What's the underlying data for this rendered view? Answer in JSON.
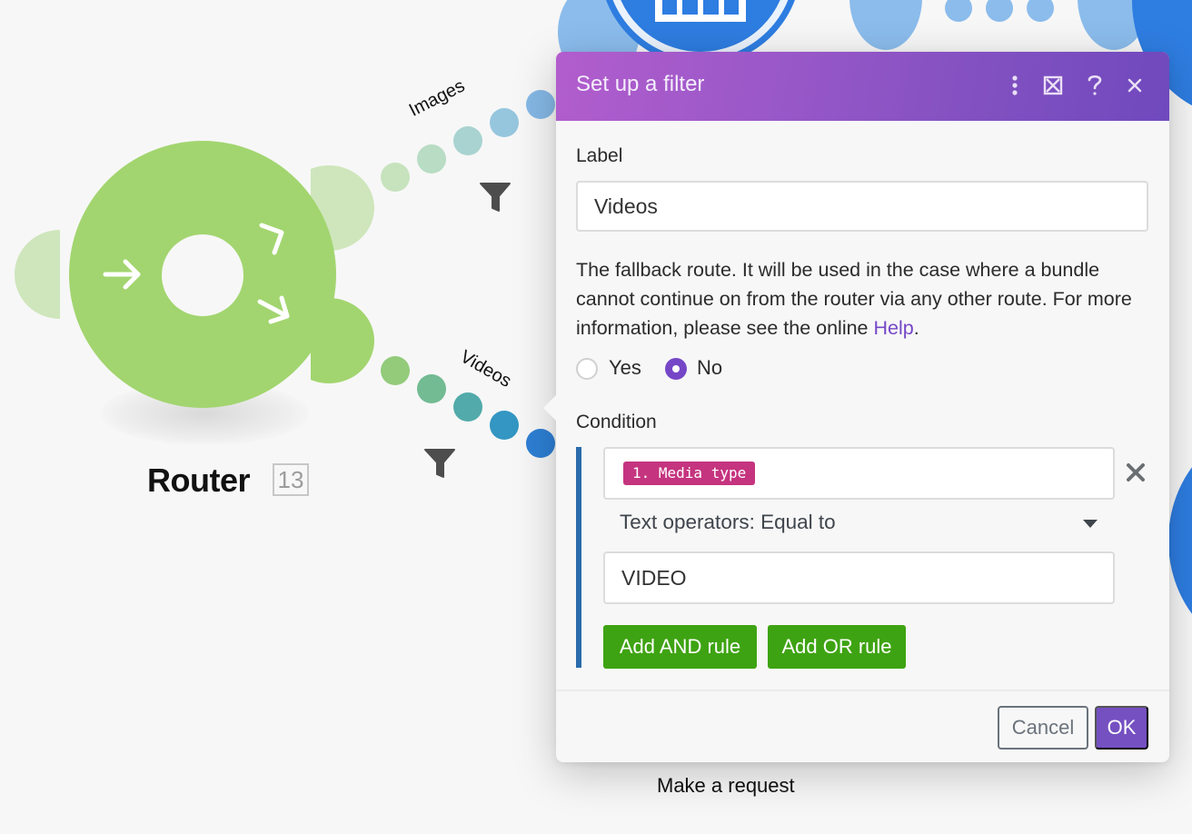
{
  "canvas": {
    "router": {
      "title": "Router",
      "badge": "13",
      "color": "#a2d56f"
    },
    "routes": [
      {
        "label": "Images",
        "has_filter": true
      },
      {
        "label": "Videos",
        "has_filter": true
      }
    ],
    "module_captions": {
      "bottom_center": "Make a request"
    },
    "icons": {
      "router_in_arrow": "arrow-right-icon",
      "router_out_arrows": "branch-arrows-icon",
      "filter": "filter-funnel-icon"
    }
  },
  "dialog": {
    "title": "Set up a filter",
    "header_actions": [
      {
        "name": "more-options",
        "icon": "vertical-dots-icon"
      },
      {
        "name": "expand",
        "icon": "expand-icon"
      },
      {
        "name": "help",
        "icon": "question-icon"
      },
      {
        "name": "close",
        "icon": "close-icon"
      }
    ],
    "label_field": {
      "label": "Label",
      "value": "Videos"
    },
    "fallback": {
      "description": "The fallback route. It will be used in the case where a bundle cannot continue on from the router via any other route. For more information, please see the online ",
      "help_link": "Help",
      "suffix": ".",
      "options": [
        {
          "label": "Yes",
          "selected": false
        },
        {
          "label": "No",
          "selected": true
        }
      ]
    },
    "condition": {
      "label": "Condition",
      "rules": [
        {
          "field_pill": "1. Media type",
          "operator": "Text operators: Equal to",
          "value": "VIDEO"
        }
      ],
      "add_and_label": "Add AND rule",
      "add_or_label": "Add OR rule"
    },
    "footer": {
      "cancel_label": "Cancel",
      "ok_label": "OK"
    },
    "colors": {
      "header_start": "#b25dcd",
      "header_end": "#7049be",
      "accent": "#7547c7",
      "pill": "#c5347f",
      "rule_button": "#3ea312",
      "condition_bar": "#2a6bad"
    }
  }
}
